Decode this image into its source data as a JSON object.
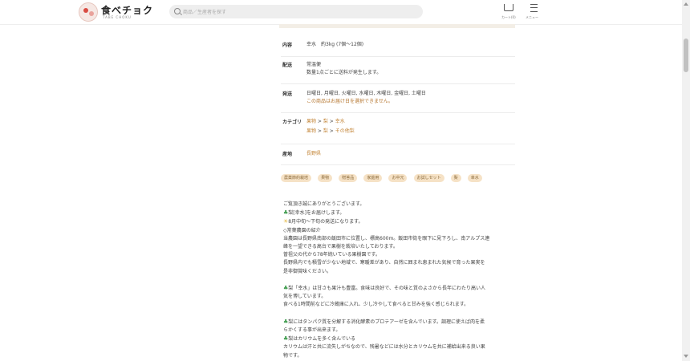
{
  "header": {
    "logo_text": "食べチョク",
    "logo_sub": "TABE CHOKU",
    "search_placeholder": "商品／生産者を探す",
    "cart_label": "カート(0)",
    "menu_label": "メニュー"
  },
  "details": {
    "naiyou": {
      "label": "内容",
      "value": "幸水　約3kg (7個〜12個)"
    },
    "haisou": {
      "label": "配送",
      "line1": "常温便",
      "line2": "数量1点ごとに送料が発生します。"
    },
    "hassou": {
      "label": "発送",
      "line1": "日曜日, 月曜日, 火曜日, 水曜日, 木曜日, 金曜日, 土曜日",
      "line2": "この商品はお届け日を選択できません。"
    },
    "category": {
      "label": "カテゴリ",
      "path1": [
        "果物",
        "梨",
        "幸水"
      ],
      "path2": [
        "果物",
        "梨",
        "その他梨"
      ],
      "sep": " > "
    },
    "sanchi": {
      "label": "産地",
      "value": "長野県"
    }
  },
  "tags": [
    "農薬節約栽培",
    "果物",
    "贈答品",
    "家庭用",
    "お中元",
    "お試しセット",
    "梨",
    "幸水"
  ],
  "description": {
    "l1": "ご覧頂き誠にありがとうございます。",
    "l2": "梨[幸水]をお届けします。",
    "l3": "8月中旬〜下旬の発送になります。",
    "l4": "◇常葉農園の紹介",
    "l5": "当農園は長野県南部の飯田市に位置し、標高600m。飯田市街を眼下に見下ろし、南アルプス連",
    "l6": "峰を一望できる高台で果樹を栽培いたしております。",
    "l7": "曽祖父の代から78年続いている果樹園です。",
    "l8": "長野県内でも積雪が少ない地域で、寒暖差があり、自然に囲まれ恵まれた気候で育った果実を",
    "l9": "是非御賞味ください。",
    "l10": "梨「幸水」は甘さも果汁も豊富。食味は良好で、その味と質のよさから長年にわたり高い人",
    "l11": "気を博しています。",
    "l12": "食べる1時間前などに冷蔵庫に入れ、少し冷やして食べると甘みを強く感じられます。",
    "l13": "梨にはタンパク質を分解する消化酵素のプロテアーゼを含んでいます。調理に使えば肉を柔",
    "l14": "らかくする事が出来ます。",
    "l15": "梨はカリウムを多く含んでいる",
    "l16": "カリウムは汗と共に流失しがちなので、残暑などには水分とカリウムを共に補給出来る良い果",
    "l17": "物です。"
  }
}
